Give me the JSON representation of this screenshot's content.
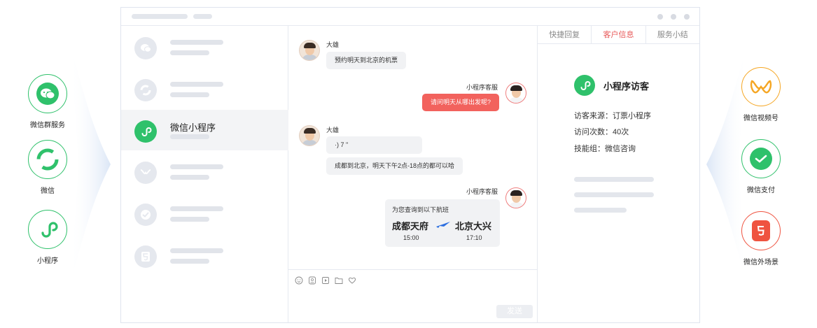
{
  "left_channels": [
    {
      "label": "微信群服务",
      "icon": "wechat-group-icon"
    },
    {
      "label": "微信",
      "icon": "wechat-icon"
    },
    {
      "label": "小程序",
      "icon": "mini-program-icon"
    }
  ],
  "right_channels": [
    {
      "label": "微信视频号",
      "icon": "video-channel-icon"
    },
    {
      "label": "微信支付",
      "icon": "wechat-pay-icon"
    },
    {
      "label": "微信外场景",
      "icon": "html5-icon"
    }
  ],
  "session_list": {
    "active_item": {
      "title": "微信小程序",
      "icon": "mini-program-icon"
    }
  },
  "chat": {
    "messages": [
      {
        "sender": "大雄",
        "text": "预约明天到北京的机票"
      },
      {
        "sender": "小程序客服",
        "text": "请问明天从哪出发呢?"
      },
      {
        "sender": "大雄",
        "voice": "·) 7 \"",
        "text": "成都到北京，明天下午2点-18点的都可以哈"
      },
      {
        "sender": "小程序客服"
      }
    ],
    "flight_card": {
      "heading": "为您查询到以下航班",
      "from": "成都天府",
      "to": "北京大兴",
      "depart": "15:00",
      "arrive": "17:10"
    },
    "send_label": "发送"
  },
  "info_panel": {
    "tabs": [
      "快捷回复",
      "客户信息",
      "服务小结"
    ],
    "active_tab": "客户信息",
    "title": "小程序访客",
    "lines": [
      "访客来源：订票小程序",
      "访问次数：40次",
      "技能组：微信咨询"
    ]
  },
  "colors": {
    "brand_green": "#2fc16b",
    "accent_red": "#f2625d",
    "orange": "#f5a623"
  }
}
